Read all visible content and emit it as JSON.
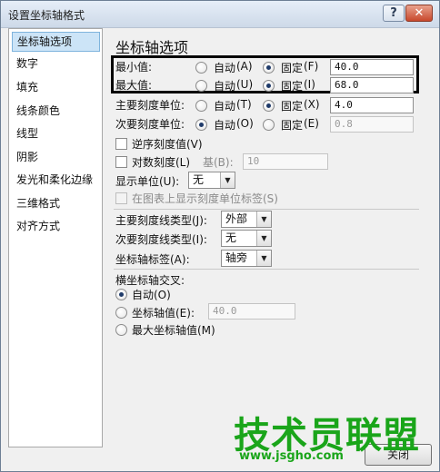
{
  "window": {
    "title": "设置坐标轴格式",
    "help_symbol": "?",
    "close_symbol": "✕"
  },
  "sidebar": {
    "items": [
      {
        "label": "坐标轴选项",
        "active": true
      },
      {
        "label": "数字"
      },
      {
        "label": "填充"
      },
      {
        "label": "线条颜色"
      },
      {
        "label": "线型"
      },
      {
        "label": "阴影"
      },
      {
        "label": "发光和柔化边缘"
      },
      {
        "label": "三维格式"
      },
      {
        "label": "对齐方式"
      }
    ]
  },
  "panel": {
    "title": "坐标轴选项",
    "auto_label": "自动",
    "fixed_label": "固定",
    "min": {
      "label": "最小值:",
      "auto_key": "(A)",
      "fixed_key": "(F)",
      "value": "40.0"
    },
    "max": {
      "label": "最大值:",
      "auto_key": "(U)",
      "fixed_key": "(I)",
      "value": "68.0"
    },
    "major_unit": {
      "label": "主要刻度单位:",
      "auto_key": "(T)",
      "fixed_key": "(X)",
      "value": "4.0"
    },
    "minor_unit": {
      "label": "次要刻度单位:",
      "auto_key": "(O)",
      "fixed_key": "(E)",
      "value": "0.8"
    },
    "reverse": {
      "label": "逆序刻度值(V)"
    },
    "log": {
      "label": "对数刻度(L)",
      "base_label": "基(B):",
      "base_value": "10"
    },
    "display_unit": {
      "label": "显示单位(U):",
      "value": "无"
    },
    "show_unit_label": {
      "label": "在图表上显示刻度单位标签(S)"
    },
    "major_tick": {
      "label": "主要刻度线类型(J):",
      "value": "外部"
    },
    "minor_tick": {
      "label": "次要刻度线类型(I):",
      "value": "无"
    },
    "axis_labels": {
      "label": "坐标轴标签(A):",
      "value": "轴旁"
    },
    "cross": {
      "title": "横坐标轴交叉:",
      "auto": "自动(O)",
      "value_label": "坐标轴值(E):",
      "value": "40.0",
      "max": "最大坐标轴值(M)"
    },
    "close_button": "关闭"
  },
  "watermark": {
    "text": "技术员联盟",
    "url": "www.jsgho.com"
  },
  "colors": {
    "accent": "#cce4f7",
    "highlight_border": "#000000",
    "watermark": "#1aa51a"
  }
}
